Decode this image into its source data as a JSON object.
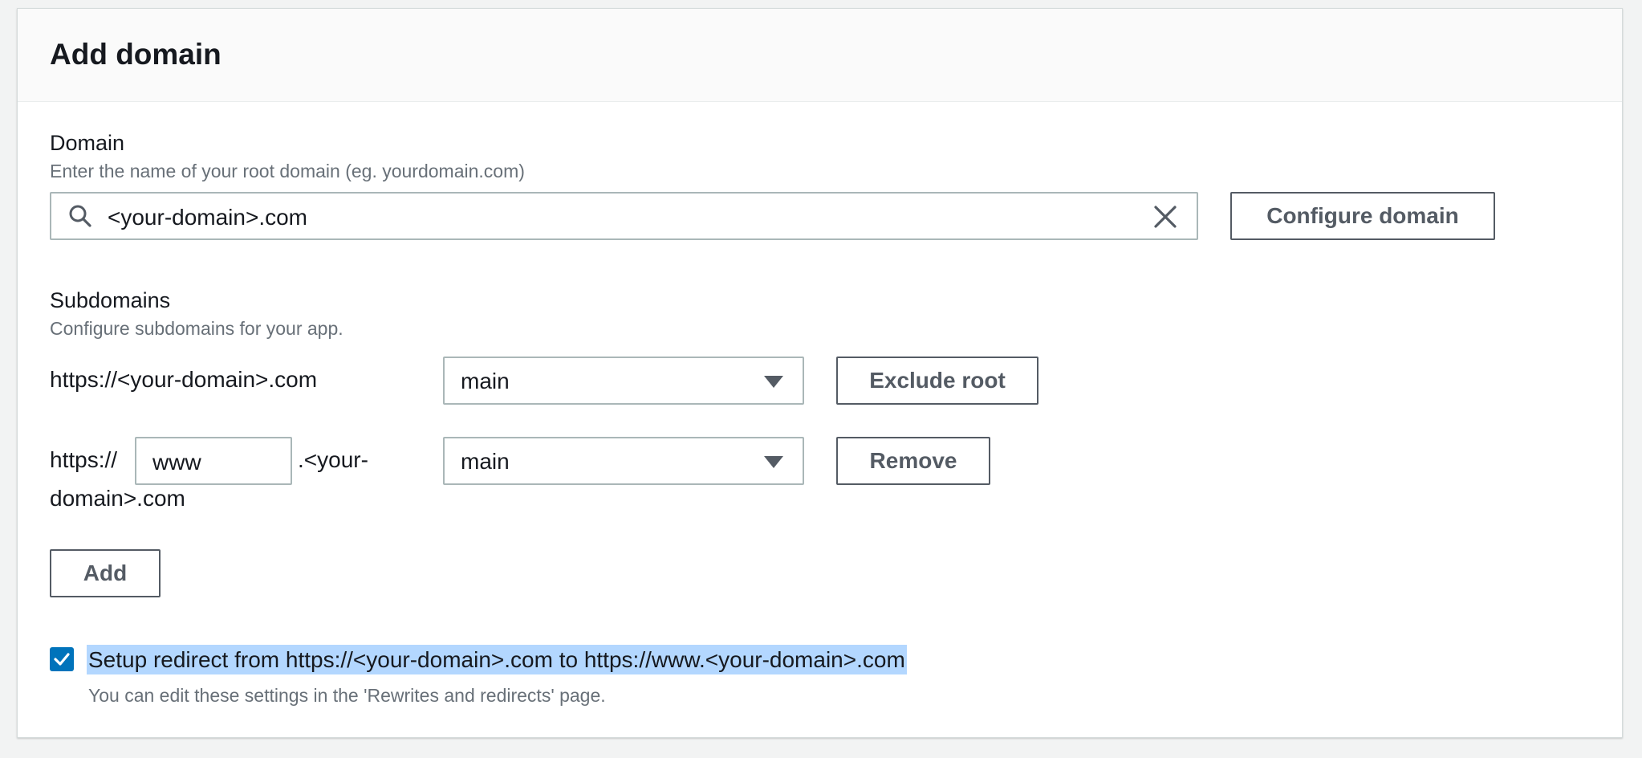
{
  "header": {
    "title": "Add domain"
  },
  "domain": {
    "label": "Domain",
    "description": "Enter the name of your root domain (eg. yourdomain.com)",
    "value": "<your-domain>.com",
    "configure_label": "Configure domain",
    "icons": [
      "search-icon",
      "clear-icon"
    ]
  },
  "subdomains": {
    "label": "Subdomains",
    "description": "Configure subdomains for your app.",
    "rows": [
      {
        "url": "https://<your-domain>.com",
        "branch": "main",
        "action_label": "Exclude root"
      },
      {
        "prefix": "https://",
        "subdomain_value": "www",
        "suffix_line1": ".<your-",
        "suffix_line2": "domain>.com",
        "branch": "main",
        "action_label": "Remove"
      }
    ],
    "add_label": "Add"
  },
  "redirect": {
    "checked": true,
    "label": "Setup redirect from https://<your-domain>.com to https://www.<your-domain>.com",
    "note": "You can edit these settings in the 'Rewrites and redirects' page."
  },
  "colors": {
    "accent": "#0073bb",
    "selection_highlight": "#b3d7ff",
    "button_border": "#545b64",
    "input_border": "#aab7b8"
  }
}
